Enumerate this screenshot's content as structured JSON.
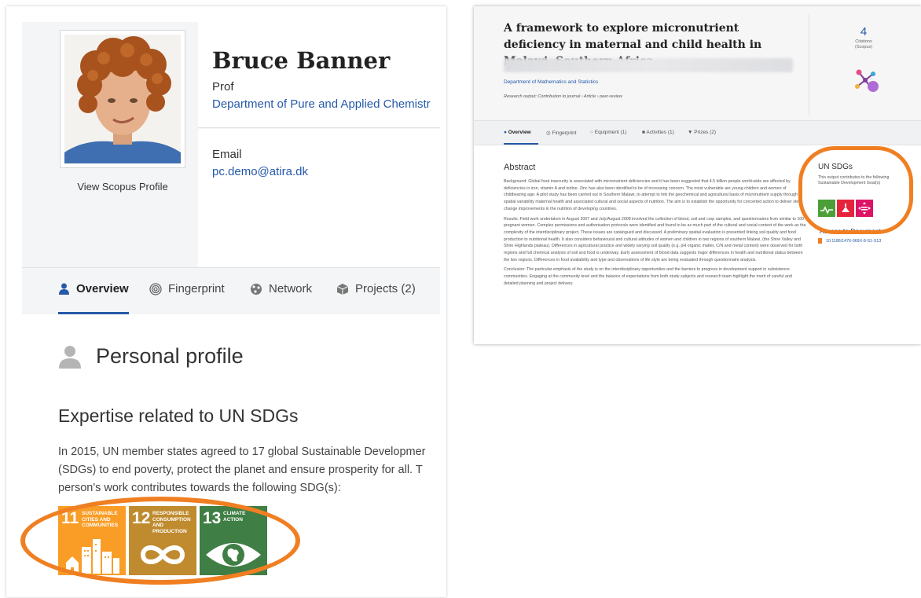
{
  "profile": {
    "name": "Bruce Banner",
    "title": "Prof",
    "department": "Department of Pure and Applied Chemistr",
    "scopus_link": "View Scopus Profile",
    "email_label": "Email",
    "email": "pc.demo@atira.dk"
  },
  "profile_tabs": [
    {
      "label": "Overview",
      "icon": "person-icon",
      "active": true
    },
    {
      "label": "Fingerprint",
      "icon": "fingerprint-icon",
      "active": false
    },
    {
      "label": "Network",
      "icon": "network-icon",
      "active": false
    },
    {
      "label": "Projects (2)",
      "icon": "projects-icon",
      "active": false
    }
  ],
  "personal_profile": {
    "heading": "Personal profile",
    "sdg_heading": "Expertise related to UN SDGs",
    "sdg_text": "In 2015, UN member states agreed to 17 global Sustainable Developmer\n(SDGs) to end poverty, protect the planet and ensure prosperity for all. T\nperson's work contributes towards the following SDG(s):"
  },
  "sdg_tiles": [
    {
      "number": "11",
      "label": "SUSTAINABLE CITIES AND COMMUNITIES",
      "color": "#f99d26",
      "icon": "city-icon"
    },
    {
      "number": "12",
      "label": "RESPONSIBLE CONSUMPTION AND PRODUCTION",
      "color": "#bf8b2e",
      "icon": "infinity-icon"
    },
    {
      "number": "13",
      "label": "CLIMATE ACTION",
      "color": "#3f7e44",
      "icon": "eye-globe-icon"
    }
  ],
  "research_output": {
    "title": "A framework to explore micronutrient deficiency in maternal and child health in Malawi, Southern Africa",
    "department": "Department of Mathematics and Statistics",
    "output_type": "Research output: Contribution to journal › Article › peer-review",
    "citations_count": "4",
    "citations_label": "Citations\n(Scopus)",
    "tabs": [
      {
        "label": "Overview",
        "active": true
      },
      {
        "label": "Fingerprint",
        "active": false
      },
      {
        "label": "Equipment (1)",
        "active": false
      },
      {
        "label": "Activities (1)",
        "active": false
      },
      {
        "label": "Prizes (2)",
        "active": false
      }
    ],
    "abstract_title": "Abstract",
    "abstract_paragraphs": [
      "Background: Global food insecurity is associated with micronutrient deficiencies and it has been suggested that 4.5 billion people world-wide are affected by deficiencies in iron, vitamin A and iodine. Zinc has also been identified to be of increasing concern. The most vulnerable are young children and women of childbearing age. A pilot study has been carried out in Southern Malawi, to attempt to link the geochemical and agricultural basis of micronutrient supply through spatial variability maternal health and associated cultural and social aspects of nutrition. The aim is to establish the opportunity for concerted action to deliver step change improvements in the nutrition of developing countries.",
      "Results: Field work undertaken in August 2007 and July/August 2008 involved the collection of blood, soil and crop samples, and questionnaires from similar to 100 pregnant women. Complex permissions and authorisation protocols were identified and found to be as much part of the cultural and social context of the work as the complexity of the interdisciplinary project. These issues are catalogued and discussed. A preliminary spatial evaluation is presented linking soil quality and food production to nutritional health. It also considers behavioural and cultural attitudes of women and children in two regions of southern Malawi, (the Shire Valley and Shire Highlands plateau). Differences in agricultural practice and widely varying soil quality (e.g. pH organic matter, C/N and metal content) were observed for both regions and full chemical analysis of soil and food is underway. Early assessment of blood data suggests major differences in health and nutritional status between the two regions. Differences in food availability and type and observations of life style are being evaluated through questionnaire analysis.",
      "Conclusion: The particular emphasis of the study is on the interdisciplinary opportunities and the barriers to progress in development support in subsistence communities. Engaging at the community level and the balance of expectations from both study subjects and research team highlight the merit of careful and detailed planning and project delivery."
    ],
    "sdg_title": "UN SDGs",
    "sdg_text": "This output contributes to the following Sustainable Development Goal(s)",
    "sdg_tiles": [
      {
        "color": "#4c9f38",
        "icon": "health-icon"
      },
      {
        "color": "#e5243b",
        "icon": "education-icon"
      },
      {
        "color": "#dd1367",
        "icon": "equality-icon"
      }
    ],
    "access_title": "Access to Document",
    "doi": "10.1186/1476-069X-8-S1-S13"
  },
  "colors": {
    "accent": "#2559a8",
    "highlight_ring": "#f07f22"
  }
}
